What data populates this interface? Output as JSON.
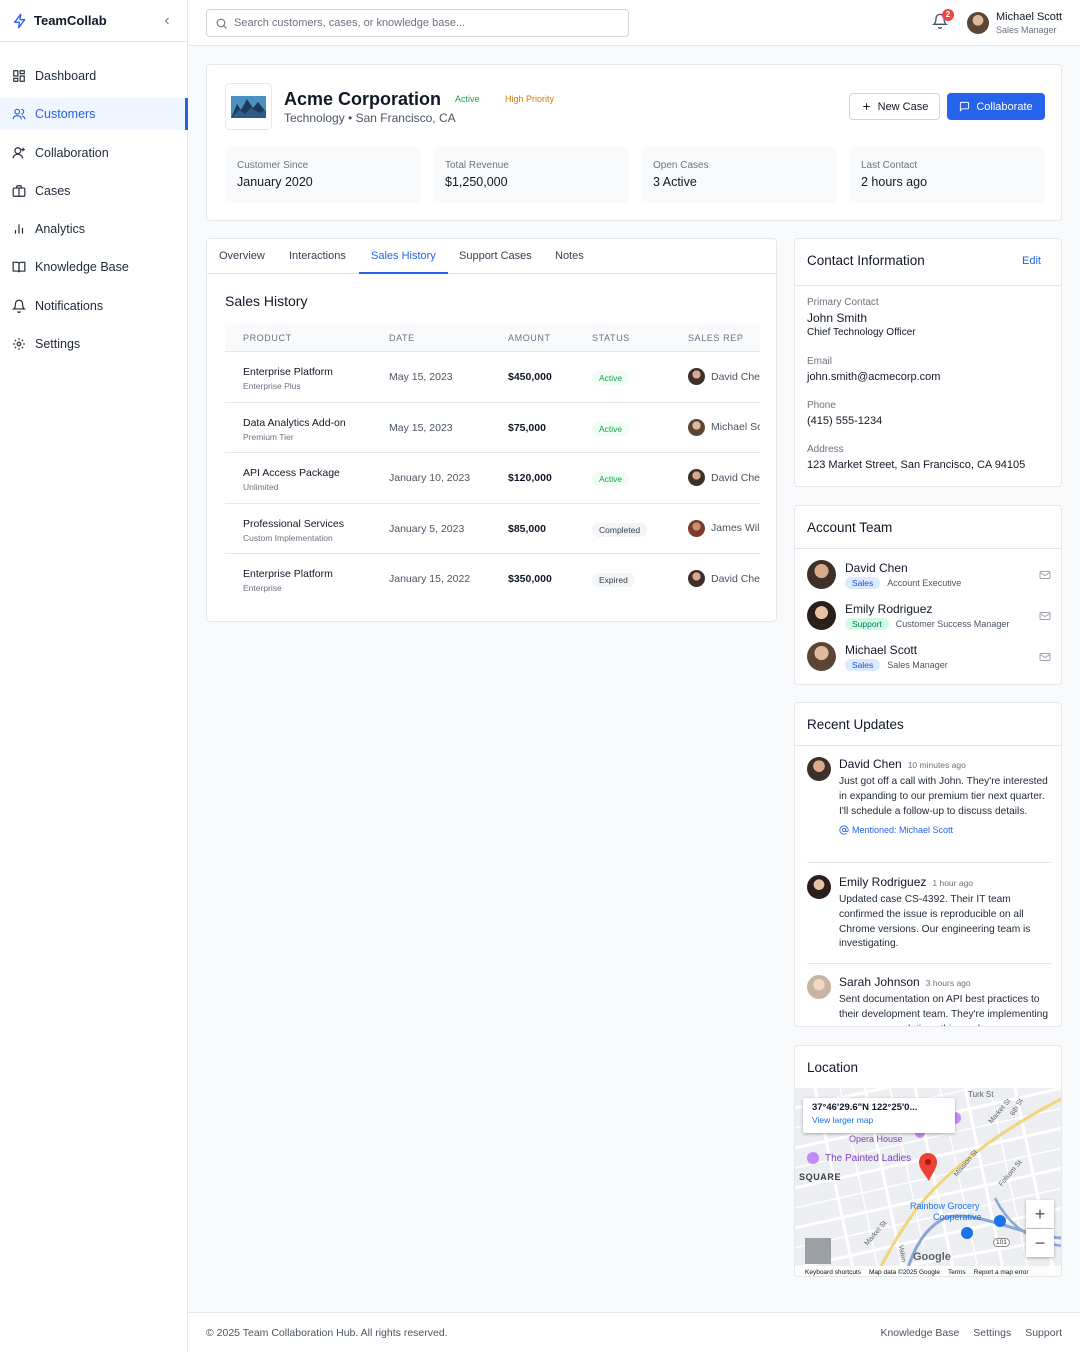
{
  "app": {
    "name": "TeamCollab"
  },
  "sidebar": {
    "items": [
      {
        "label": "Dashboard",
        "icon": "dashboard-icon"
      },
      {
        "label": "Customers",
        "icon": "users-icon",
        "active": true
      },
      {
        "label": "Collaboration",
        "icon": "collaboration-icon"
      },
      {
        "label": "Cases",
        "icon": "briefcase-icon"
      },
      {
        "label": "Analytics",
        "icon": "bar-chart-icon"
      },
      {
        "label": "Knowledge Base",
        "icon": "book-icon"
      },
      {
        "label": "Notifications",
        "icon": "bell-icon"
      },
      {
        "label": "Settings",
        "icon": "gear-icon"
      }
    ]
  },
  "topbar": {
    "search_placeholder": "Search customers, cases, or knowledge base...",
    "notification_count": "2",
    "user": {
      "name": "Michael Scott",
      "role": "Sales Manager"
    }
  },
  "customer": {
    "name": "Acme Corporation",
    "subtitle": "Technology • San Francisco, CA",
    "status": "Active",
    "priority": "High Priority",
    "new_case_label": "New Case",
    "collaborate_label": "Collaborate",
    "stats": [
      {
        "label": "Customer Since",
        "value": "January 2020"
      },
      {
        "label": "Total Revenue",
        "value": "$1,250,000"
      },
      {
        "label": "Open Cases",
        "value": "3 Active"
      },
      {
        "label": "Last Contact",
        "value": "2 hours ago"
      }
    ]
  },
  "tabs": [
    {
      "label": "Overview"
    },
    {
      "label": "Interactions"
    },
    {
      "label": "Sales History",
      "active": true
    },
    {
      "label": "Support Cases"
    },
    {
      "label": "Notes"
    }
  ],
  "sales": {
    "title": "Sales History",
    "columns": [
      "PRODUCT",
      "DATE",
      "AMOUNT",
      "STATUS",
      "SALES REP"
    ],
    "rows": [
      {
        "product": "Enterprise Platform",
        "tier": "Enterprise Plus",
        "date": "May 15, 2023",
        "amount": "$450,000",
        "status": "Active",
        "rep": "David Chen"
      },
      {
        "product": "Data Analytics Add-on",
        "tier": "Premium Tier",
        "date": "May 15, 2023",
        "amount": "$75,000",
        "status": "Active",
        "rep": "Michael Scott"
      },
      {
        "product": "API Access Package",
        "tier": "Unlimited",
        "date": "January 10, 2023",
        "amount": "$120,000",
        "status": "Active",
        "rep": "David Chen"
      },
      {
        "product": "Professional Services",
        "tier": "Custom Implementation",
        "date": "January 5, 2023",
        "amount": "$85,000",
        "status": "Completed",
        "rep": "James Wilson"
      },
      {
        "product": "Enterprise Platform",
        "tier": "Enterprise",
        "date": "January 15, 2022",
        "amount": "$350,000",
        "status": "Expired",
        "rep": "David Chen"
      }
    ]
  },
  "contact": {
    "title": "Contact Information",
    "edit_label": "Edit",
    "primary_label": "Primary Contact",
    "primary_name": "John Smith",
    "primary_title": "Chief Technology Officer",
    "email_label": "Email",
    "email": "john.smith@acmecorp.com",
    "phone_label": "Phone",
    "phone": "(415) 555-1234",
    "address_label": "Address",
    "address": "123 Market Street, San Francisco, CA 94105"
  },
  "team": {
    "title": "Account Team",
    "members": [
      {
        "name": "David Chen",
        "tag": "Sales",
        "role": "Account Executive"
      },
      {
        "name": "Emily Rodriguez",
        "tag": "Support",
        "role": "Customer Success Manager"
      },
      {
        "name": "Michael Scott",
        "tag": "Sales",
        "role": "Sales Manager"
      }
    ]
  },
  "updates": {
    "title": "Recent Updates",
    "items": [
      {
        "name": "David Chen",
        "time": "10 minutes ago",
        "text": "Just got off a call with John. They're interested in expanding to our premium tier next quarter. I'll schedule a follow-up to discuss details.",
        "mention": "Mentioned: Michael Scott"
      },
      {
        "name": "Emily Rodriguez",
        "time": "1 hour ago",
        "text": "Updated case CS-4392. Their IT team confirmed the issue is reproducible on all Chrome versions. Our engineering team is investigating."
      },
      {
        "name": "Sarah Johnson",
        "time": "3 hours ago",
        "text": "Sent documentation on API best practices to their development team. They're implementing our recommendations this week."
      }
    ]
  },
  "location": {
    "title": "Location",
    "coord": "37°46'29.6\"N 122°25'0...",
    "view_larger": "View larger map",
    "labels": {
      "opera": "Opera House",
      "ladies": "The Painted Ladies",
      "square": "SQUARE",
      "rainbow1": "Rainbow Grocery",
      "rainbow2": "Cooperative",
      "turk": "Turk St",
      "market1": "Market St",
      "market2": "Market St",
      "mission": "Mission St",
      "folsom": "Folsom St",
      "sixth": "6th St",
      "valencia": "Valen",
      "hwy": "101",
      "google": "Google"
    },
    "footer": [
      "Keyboard shortcuts",
      "Map data ©2025 Google",
      "Terms",
      "Report a map error"
    ]
  },
  "footer": {
    "copyright": "© 2025 Team Collaboration Hub. All rights reserved.",
    "links": [
      "Knowledge Base",
      "Settings",
      "Support"
    ]
  }
}
